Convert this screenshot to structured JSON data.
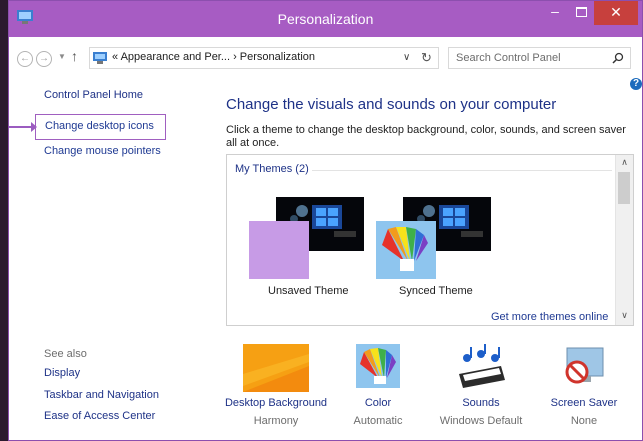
{
  "window": {
    "title": "Personalization"
  },
  "address": {
    "crumbs": "«  Appearance and Per...  ›  Personalization",
    "search_placeholder": "Search Control Panel"
  },
  "left_nav": {
    "home": "Control Panel Home",
    "desktop_icons": "Change desktop icons",
    "mouse_pointers": "Change mouse pointers",
    "see_also": "See also",
    "see_also_links": [
      "Display",
      "Taskbar and Navigation",
      "Ease of Access Center"
    ]
  },
  "main": {
    "title": "Change the visuals and sounds on your computer",
    "description": "Click a theme to change the desktop background, color, sounds, and screen saver all at once.",
    "group_label": "My Themes (2)",
    "themes": [
      {
        "name": "Unsaved Theme",
        "accent": "#c79be6"
      },
      {
        "name": "Synced Theme",
        "accent": "#8ec5ee"
      }
    ],
    "more_online": "Get more themes online"
  },
  "bottom_items": [
    {
      "label": "Desktop Background",
      "value": "Harmony",
      "icon": "desktop-background-icon"
    },
    {
      "label": "Color",
      "value": "Automatic",
      "icon": "color-icon"
    },
    {
      "label": "Sounds",
      "value": "Windows Default",
      "icon": "sounds-icon"
    },
    {
      "label": "Screen Saver",
      "value": "None",
      "icon": "screen-saver-icon"
    }
  ],
  "colors": {
    "titlebar": "#a75cc3",
    "close": "#c7403d",
    "link": "#1e3287",
    "highlight_border": "#a05fc0"
  }
}
